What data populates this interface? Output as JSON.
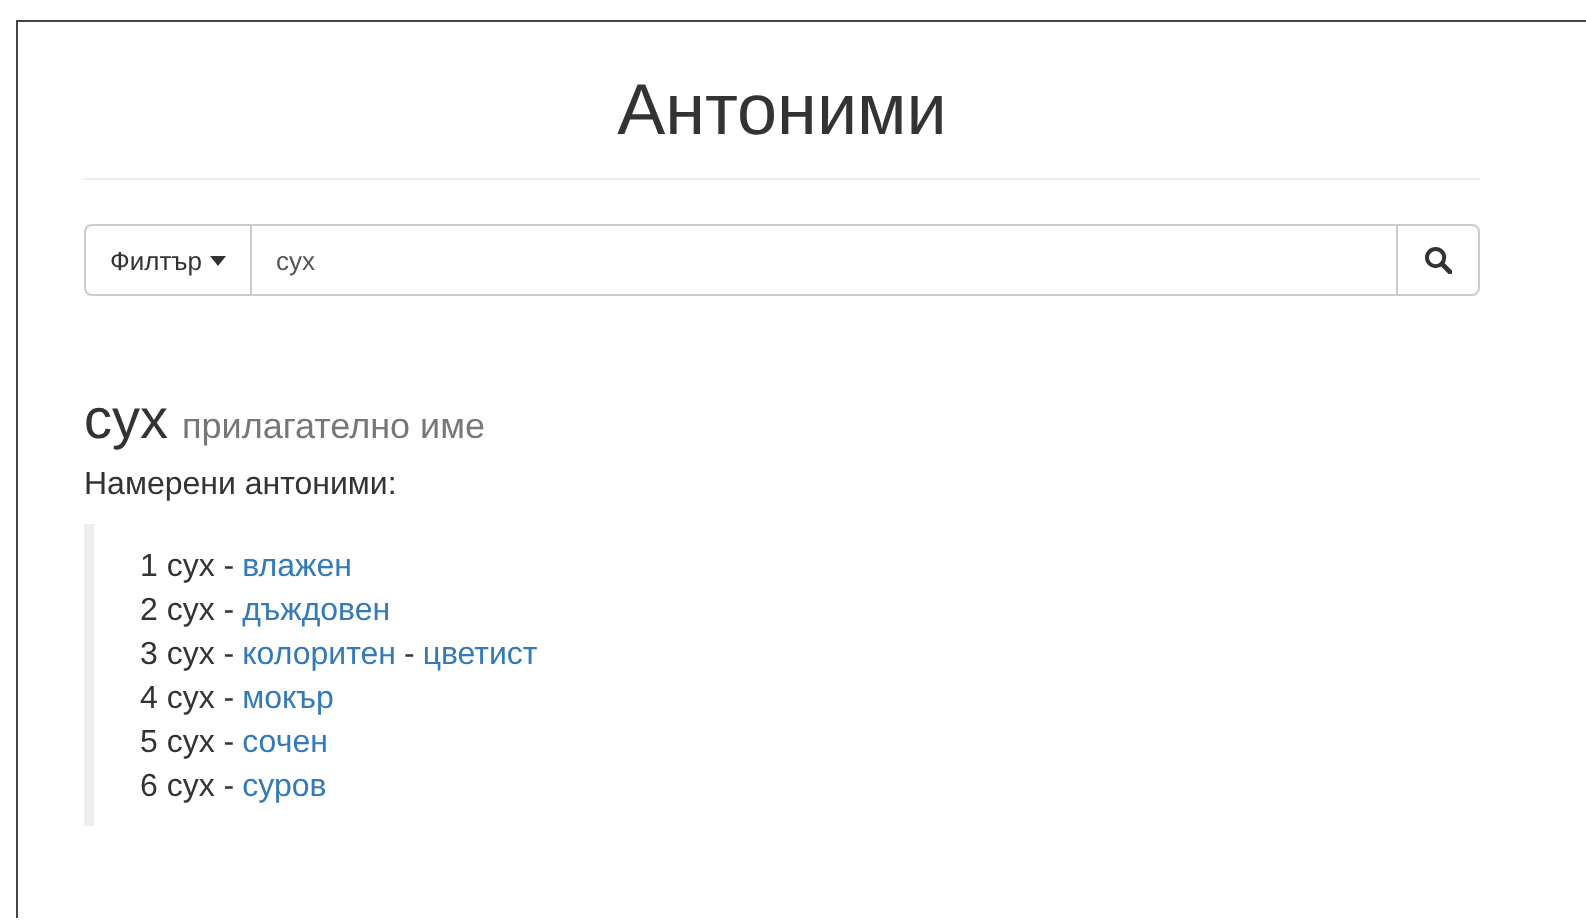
{
  "title": "Антоними",
  "search": {
    "filter_label": "Филтър",
    "value": "сух"
  },
  "result": {
    "word": "сух",
    "part_of_speech": "прилагателно име",
    "found_label": "Намерени антоними:",
    "items": [
      {
        "parts": [
          {
            "kind": "text",
            "text": "1 сух -"
          },
          {
            "kind": "link",
            "text": "влажен"
          }
        ]
      },
      {
        "parts": [
          {
            "kind": "text",
            "text": "2 сух -"
          },
          {
            "kind": "link",
            "text": "дъждовен"
          }
        ]
      },
      {
        "parts": [
          {
            "kind": "text",
            "text": "3 сух -"
          },
          {
            "kind": "link",
            "text": "колоритен"
          },
          {
            "kind": "text",
            "text": "-"
          },
          {
            "kind": "link",
            "text": "цветист"
          }
        ]
      },
      {
        "parts": [
          {
            "kind": "text",
            "text": "4 сух -"
          },
          {
            "kind": "link",
            "text": "мокър"
          }
        ]
      },
      {
        "parts": [
          {
            "kind": "text",
            "text": "5 сух -"
          },
          {
            "kind": "link",
            "text": "сочен"
          }
        ]
      },
      {
        "parts": [
          {
            "kind": "text",
            "text": "6 сух -"
          },
          {
            "kind": "link",
            "text": "суров"
          }
        ]
      }
    ]
  }
}
